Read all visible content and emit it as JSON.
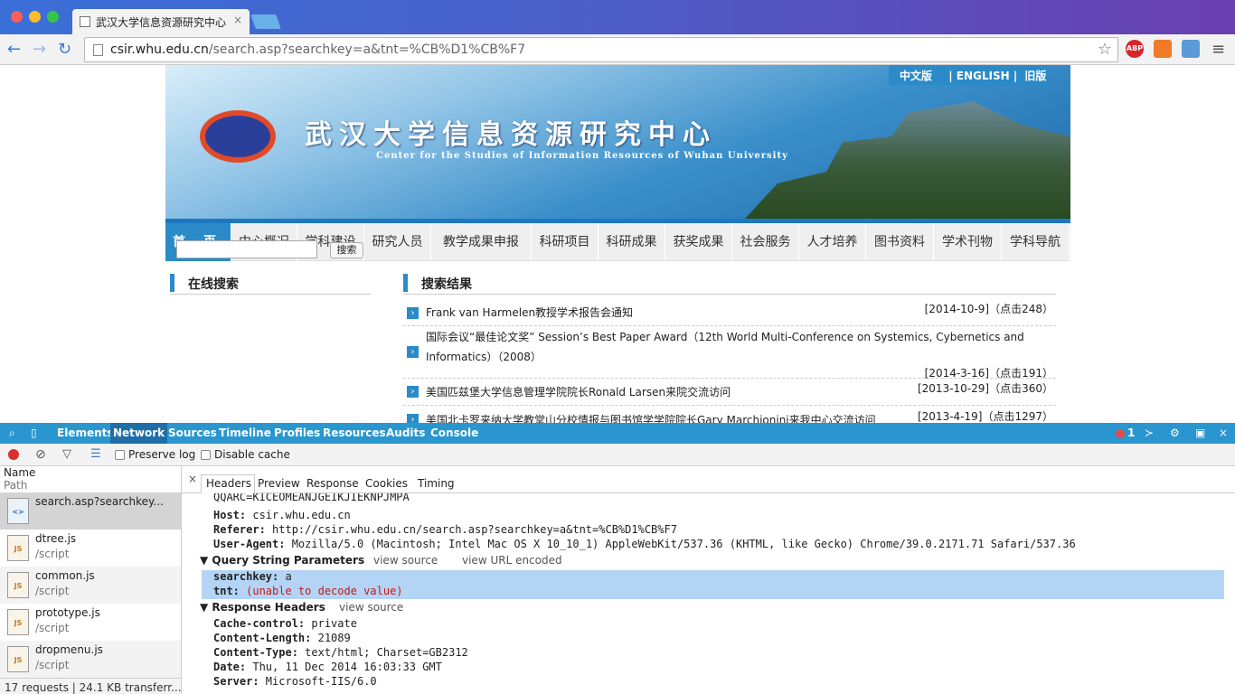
{
  "browser": {
    "tab_title": "武汉大学信息资源研究中心",
    "tab_close": "×",
    "url_host": "csir.whu.edu.cn",
    "url_path": "/search.asp?searchkey=a&tnt=%CB%D1%CB%F7",
    "star_glyph": "☆",
    "back_glyph": "←",
    "forward_glyph": "→",
    "reload_glyph": "↻",
    "menu_glyph": "≡",
    "ext_abp": "ABP"
  },
  "site": {
    "lang_cn": "中文版",
    "lang_en": "| ENGLISH |",
    "lang_old": "旧版",
    "banner_cn": "武汉大学信息资源研究中心",
    "banner_en": "Center for the Studies of Information Resources of Wuhan University",
    "nav": [
      "首页",
      "中心概况",
      "学科建设",
      "研究人员",
      "教学成果申报",
      "科研项目",
      "科研成果",
      "获奖成果",
      "社会服务",
      "人才培养",
      "图书资料",
      "学术刊物",
      "学科导航"
    ],
    "search_heading": "在线搜索",
    "search_button": "搜索",
    "results_heading": "搜索结果",
    "results": [
      {
        "title": "Frank van Harmelen教授学术报告会通知",
        "date": "[2014-10-9]（点击248）"
      },
      {
        "title": "国际会议“最佳论文奖” Session’s Best Paper Award（12th World Multi-Conference on Systemics, Cybernetics and Informatics）（2008）",
        "date": "[2014-3-16]（点击191）"
      },
      {
        "title": "美国匹兹堡大学信息管理学院院长Ronald Larsen来院交流访问",
        "date": "[2013-10-29]（点击360）"
      },
      {
        "title": "美国北卡罗来纳大学教堂山分校情报与图书馆学学院院长Gary Marchionini来我中心交流访问",
        "date": "[2013-4-19]（点击1297）"
      }
    ]
  },
  "devtools": {
    "tabs": [
      "Elements",
      "Network",
      "Sources",
      "Timeline",
      "Profiles",
      "Resources",
      "Audits",
      "Console"
    ],
    "error_count": "1",
    "preserve_log": "Preserve log",
    "disable_cache": "Disable cache",
    "col_name": "Name",
    "col_path": "Path",
    "requests": [
      {
        "name": "search.asp?searchkey...",
        "path": "",
        "type": "<>"
      },
      {
        "name": "dtree.js",
        "path": "/script",
        "type": "JS"
      },
      {
        "name": "common.js",
        "path": "/script",
        "type": "JS"
      },
      {
        "name": "prototype.js",
        "path": "/script",
        "type": "JS"
      },
      {
        "name": "dropmenu.js",
        "path": "/script",
        "type": "JS"
      }
    ],
    "status": "17 requests | 24.1 KB transferr...",
    "subtabs": [
      "Headers",
      "Preview",
      "Response",
      "Cookies",
      "Timing"
    ],
    "close_glyph": "×",
    "cookie_tail": "QQARC=KICEOMEANJGEIKJIEKNPJMPA",
    "req_headers": [
      {
        "k": "Host:",
        "v": " csir.whu.edu.cn"
      },
      {
        "k": "Referer:",
        "v": " http://csir.whu.edu.cn/search.asp?searchkey=a&tnt=%CB%D1%CB%F7"
      },
      {
        "k": "User-Agent:",
        "v": " Mozilla/5.0 (Macintosh; Intel Mac OS X 10_10_1) AppleWebKit/537.36 (KHTML, like Gecko) Chrome/39.0.2171.71 Safari/537.36"
      }
    ],
    "qs_title": "▼ Query String Parameters",
    "qs_view_source": "view source",
    "qs_view_url": "view URL encoded",
    "qs_params": [
      {
        "k": "searchkey:",
        "v": " a"
      },
      {
        "k": "tnt:",
        "v": " (unable to decode value)"
      }
    ],
    "resp_title": "▼ Response Headers",
    "resp_view_source": "view source",
    "resp_headers": [
      {
        "k": "Cache-control:",
        "v": " private"
      },
      {
        "k": "Content-Length:",
        "v": " 21089"
      },
      {
        "k": "Content-Type:",
        "v": " text/html; Charset=GB2312"
      },
      {
        "k": "Date:",
        "v": " Thu, 11 Dec 2014 16:03:33 GMT"
      },
      {
        "k": "Server:",
        "v": " Microsoft-IIS/6.0"
      }
    ]
  }
}
